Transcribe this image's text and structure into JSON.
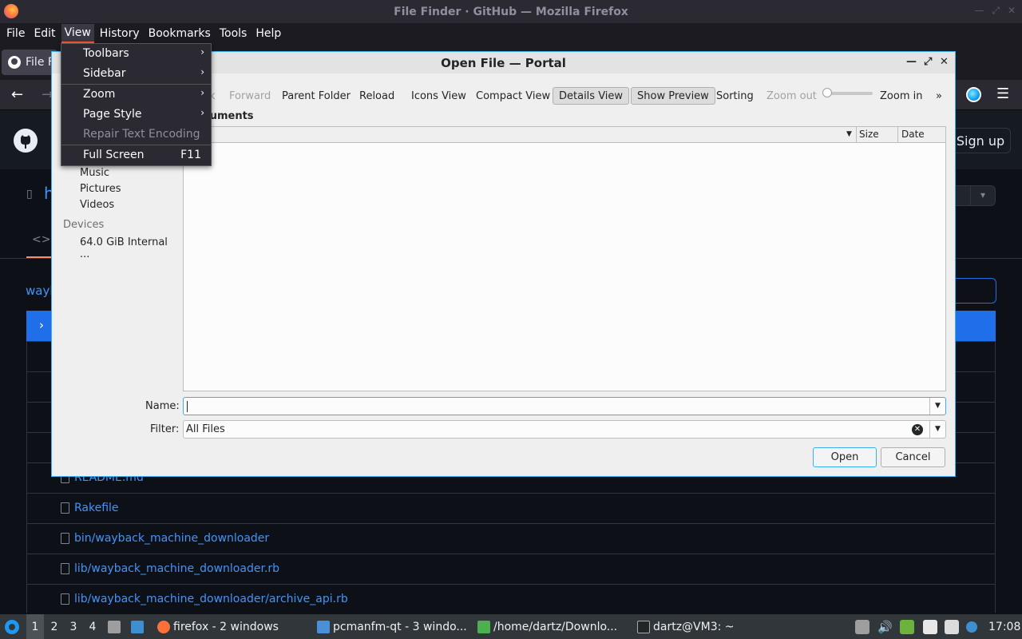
{
  "window": {
    "title": "File Finder · GitHub — Mozilla Firefox"
  },
  "menubar": [
    "File",
    "Edit",
    "View",
    "History",
    "Bookmarks",
    "Tools",
    "Help"
  ],
  "tab": {
    "label": "File F"
  },
  "github": {
    "signup": "Sign up",
    "repo_prefix": "h",
    "code_tab": "<>",
    "breadcrumb": "wayl",
    "files": [
      "README.md",
      "Rakefile",
      "bin/wayback_machine_downloader",
      "lib/wayback_machine_downloader.rb",
      "lib/wayback_machine_downloader/archive_api.rb"
    ]
  },
  "view_menu": {
    "items": [
      {
        "label": "Toolbars",
        "submenu": true
      },
      {
        "label": "Sidebar",
        "submenu": true
      },
      {
        "label": "Zoom",
        "submenu": true
      },
      {
        "label": "Page Style",
        "submenu": true
      },
      {
        "label": "Repair Text Encoding",
        "disabled": true
      },
      {
        "label": "Full Screen",
        "accel": "F11"
      }
    ]
  },
  "dialog": {
    "title": "Open File — Portal",
    "toolbar": {
      "back": "k",
      "forward": "Forward",
      "parent": "Parent Folder",
      "reload": "Reload",
      "icons": "Icons View",
      "compact": "Compact View",
      "details": "Details View",
      "preview": "Show Preview",
      "sorting": "Sorting",
      "zoom_out": "Zoom out",
      "zoom_in": "Zoom in",
      "more": "»"
    },
    "breadcrumb": "cuments",
    "sidebar": {
      "places": [
        "Music",
        "Pictures",
        "Videos"
      ],
      "devices_header": "Devices",
      "devices": [
        "64.0 GiB Internal ..."
      ]
    },
    "columns": {
      "size": "Size",
      "date": "Date"
    },
    "name_label": "Name:",
    "name_value": "",
    "filter_label": "Filter:",
    "filter_value": "All Files",
    "open": "Open",
    "cancel": "Cancel"
  },
  "taskbar": {
    "workspaces": [
      "1",
      "2",
      "3",
      "4"
    ],
    "tasks": [
      {
        "label": "firefox - 2 windows",
        "color": "#ff7139"
      },
      {
        "label": "pcmanfm-qt - 3 windo...",
        "color": "#4a90d9"
      },
      {
        "label": "/home/dartz/Downlo...",
        "color": "#4caf50"
      },
      {
        "label": "dartz@VM3: ~",
        "color": "#232627"
      }
    ],
    "clock": "17:08"
  },
  "colors": {
    "accent": "#3daee9",
    "github_blue": "#4493f8",
    "firefox_orange": "#ff7139"
  }
}
